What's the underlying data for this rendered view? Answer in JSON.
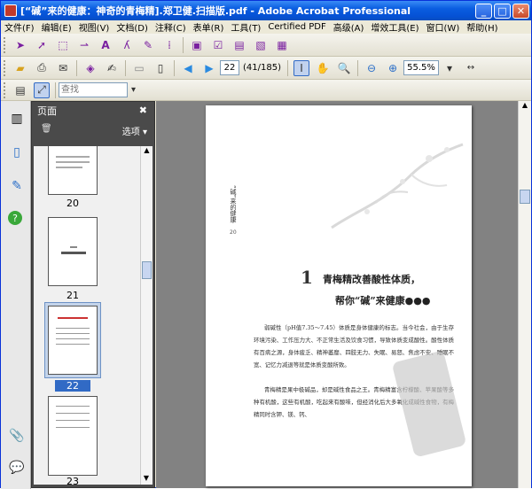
{
  "window": {
    "title": "[“碱”来的健康：神奇的青梅精].郑卫健.扫描版.pdf - Adobe Acrobat Professional"
  },
  "menu": [
    "文件(F)",
    "编辑(E)",
    "视图(V)",
    "文档(D)",
    "注释(C)",
    "表单(R)",
    "工具(T)",
    "Certified PDF",
    "高级(A)",
    "增效工具(E)",
    "窗口(W)",
    "帮助(H)"
  ],
  "toolbar": {
    "page_current": "22",
    "page_total": "(41/185)",
    "zoom": "55.5%",
    "find_placeholder": "查找"
  },
  "panel": {
    "title": "页面",
    "options": "选项 ▾",
    "close": "✖"
  },
  "thumbnails": [
    {
      "label": "20"
    },
    {
      "label": "21"
    },
    {
      "label": "22",
      "selected": true
    },
    {
      "label": "23"
    }
  ],
  "document": {
    "side_title": "“碱”来的健康",
    "side_page": "20",
    "chapter_number": "1",
    "chapter_title_1": "青梅精改善酸性体质，",
    "chapter_title_2": "帮你“碱”来健康●●●",
    "paragraph_1": "弱碱性（pH值7.35～7.45）体质是身体健康的标志。当今社会，由于生存环境污染、工作压力大、不正常生活及饮食习惯，导致体质变成酸性。酸性体质有百病之源，身体疲乏、精神萎靡、四肢无力、失眠、易怒、焦虑不安、睡眠不宽、记忆力减退等就是体质变酸所致。",
    "paragraph_2": "青梅精是果中极碱品，却是碱性食品之王。青梅精富含柠檬酸、苹果酸等多种有机酸，这些有机酸，吃起来有酸味，但经消化后大多氧化成碱性食物，有梅精同时含钾、镁、钙、"
  }
}
